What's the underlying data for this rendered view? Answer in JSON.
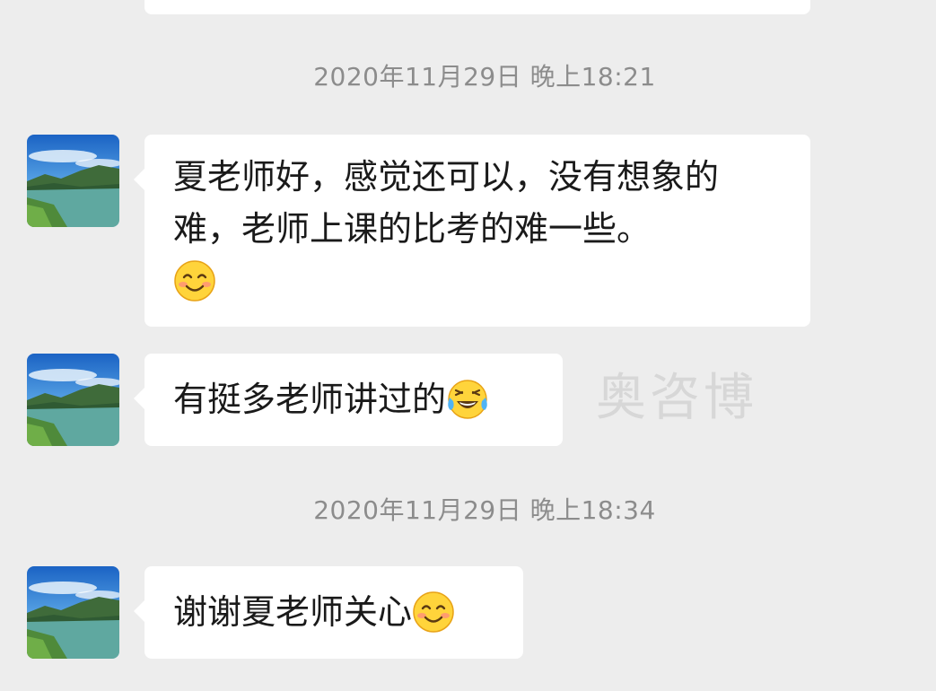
{
  "conversation": {
    "messages": [
      {
        "timestamp": "2020年11月29日 晚上18:21",
        "text": "夏老师好，感觉还可以，没有想象的难，老师上课的比考的难一些。",
        "emoji": "smiling-face-icon"
      },
      {
        "text": "有挺多老师讲过的",
        "emoji": "tears-of-joy-icon"
      },
      {
        "timestamp": "2020年11月29日 晚上18:34",
        "text": "谢谢夏老师关心",
        "emoji": "smiling-face-icon"
      }
    ]
  },
  "watermark": "奥咨博",
  "colors": {
    "background": "#ededed",
    "bubble": "#ffffff",
    "timestamp": "#8c8c8c",
    "text": "#1a1a1a",
    "emoji_yellow": "#ffd43b"
  }
}
